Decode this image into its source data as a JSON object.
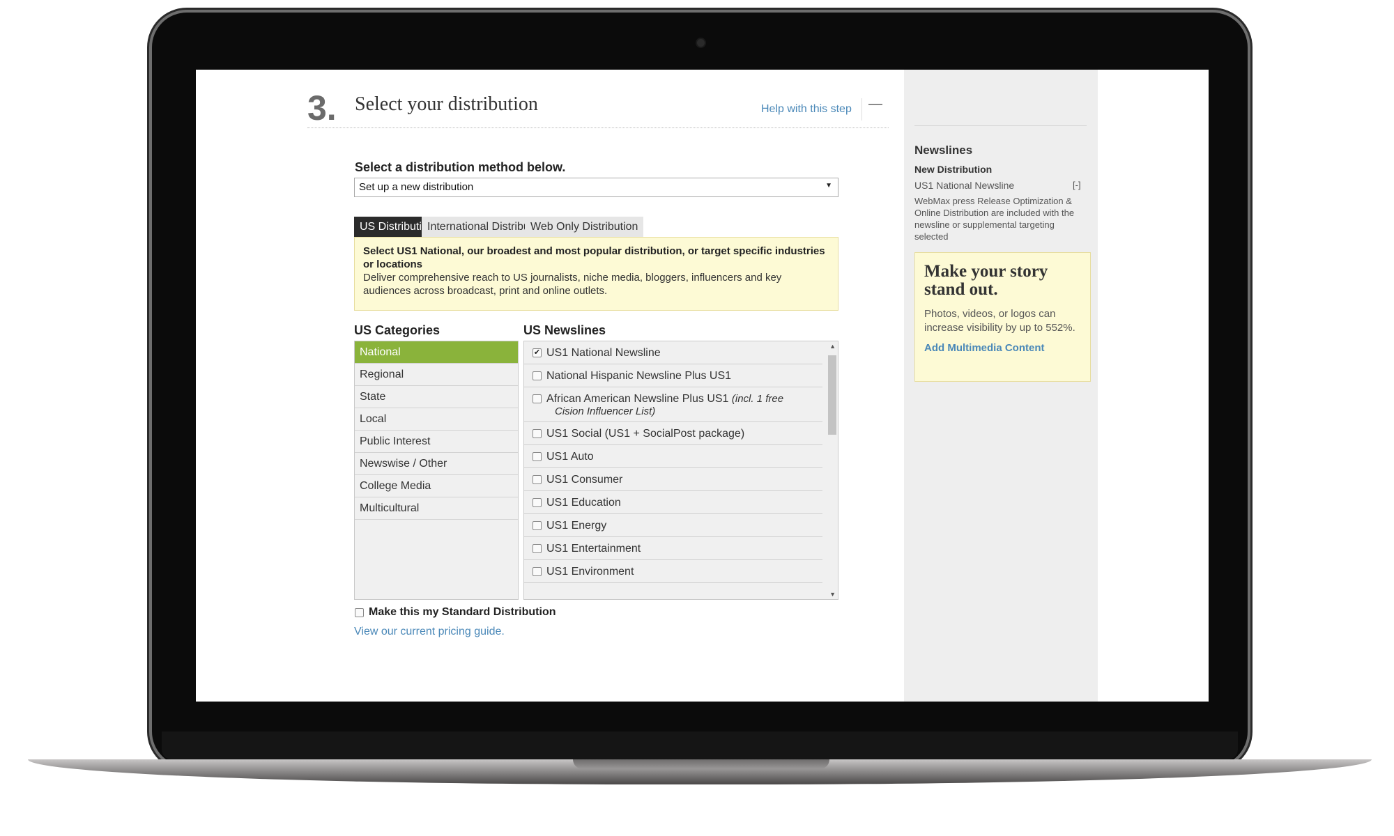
{
  "step": {
    "number": "3.",
    "title": "Select your distribution",
    "help_label": "Help with this step",
    "collapse_symbol": "—"
  },
  "method": {
    "label": "Select a distribution method below.",
    "selected": "Set up a new distribution",
    "caret": "▼"
  },
  "tabs": [
    {
      "label": "US Distribution",
      "active": true
    },
    {
      "label": "International Distribution",
      "active": false
    },
    {
      "label": "Web Only Distribution",
      "active": false
    }
  ],
  "info": {
    "headline": "Select US1 National, our broadest and most popular distribution, or target specific industries or locations",
    "body": "Deliver comprehensive reach to US journalists, niche media, bloggers, influencers and key audiences across broadcast, print and online outlets."
  },
  "categories": {
    "heading": "US Categories",
    "items": [
      "National",
      "Regional",
      "State",
      "Local",
      "Public Interest",
      "Newswise / Other",
      "College Media",
      "Multicultural"
    ],
    "active_index": 0
  },
  "newslines": {
    "heading": "US Newslines",
    "items": [
      {
        "label": "US1 National Newsline",
        "checked": true
      },
      {
        "label": "National Hispanic Newsline Plus US1",
        "checked": false
      },
      {
        "label": "African American Newsline Plus US1",
        "note_a": "(incl. 1 free",
        "note_b": "Cision Influencer List)",
        "checked": false
      },
      {
        "label": "US1 Social (US1 + SocialPost package)",
        "checked": false
      },
      {
        "label": "US1 Auto",
        "checked": false
      },
      {
        "label": "US1 Consumer",
        "checked": false
      },
      {
        "label": "US1 Education",
        "checked": false
      },
      {
        "label": "US1 Energy",
        "checked": false
      },
      {
        "label": "US1 Entertainment",
        "checked": false
      },
      {
        "label": "US1 Environment",
        "checked": false
      }
    ],
    "scroll_up": "▲",
    "scroll_down": "▼"
  },
  "standard": {
    "label": "Make this my Standard Distribution",
    "checked": false
  },
  "pricing_link": "View our current pricing guide.",
  "sidebar": {
    "heading": "Newslines",
    "subheading": "New Distribution",
    "selected_line": "US1 National Newsline",
    "remove_label": "[-]",
    "description": "WebMax press Release Optimization & Online Distribution are included with the newsline or supplemental targeting selected",
    "promo": {
      "title": "Make your story stand out.",
      "text": "Photos, videos, or logos can increase visibility by up to 552%.",
      "link": "Add Multimedia Content"
    }
  },
  "colors": {
    "accent_green": "#8ab33b",
    "link_blue": "#4a88b8",
    "info_bg": "#fdfad5",
    "tab_active": "#2b2b2b"
  }
}
